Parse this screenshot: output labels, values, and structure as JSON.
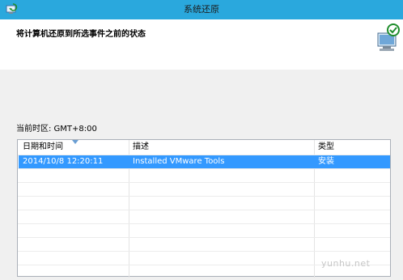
{
  "window": {
    "title": "系统还原"
  },
  "header": {
    "heading": "将计算机还原到所选事件之前的状态"
  },
  "timezone_label": "当前时区: GMT+8:00",
  "table": {
    "columns": [
      "日期和时间",
      "描述",
      "类型"
    ],
    "rows": [
      {
        "date": "2014/10/8 12:20:11",
        "description": "Installed VMware Tools",
        "type": "安装",
        "selected": true
      }
    ]
  },
  "watermark": "yunhu.net",
  "colors": {
    "titlebar": "#2aa8dd",
    "selection": "#3399ff"
  },
  "icons": {
    "app": "system-restore-icon",
    "wizard": "computer-restore-icon"
  }
}
